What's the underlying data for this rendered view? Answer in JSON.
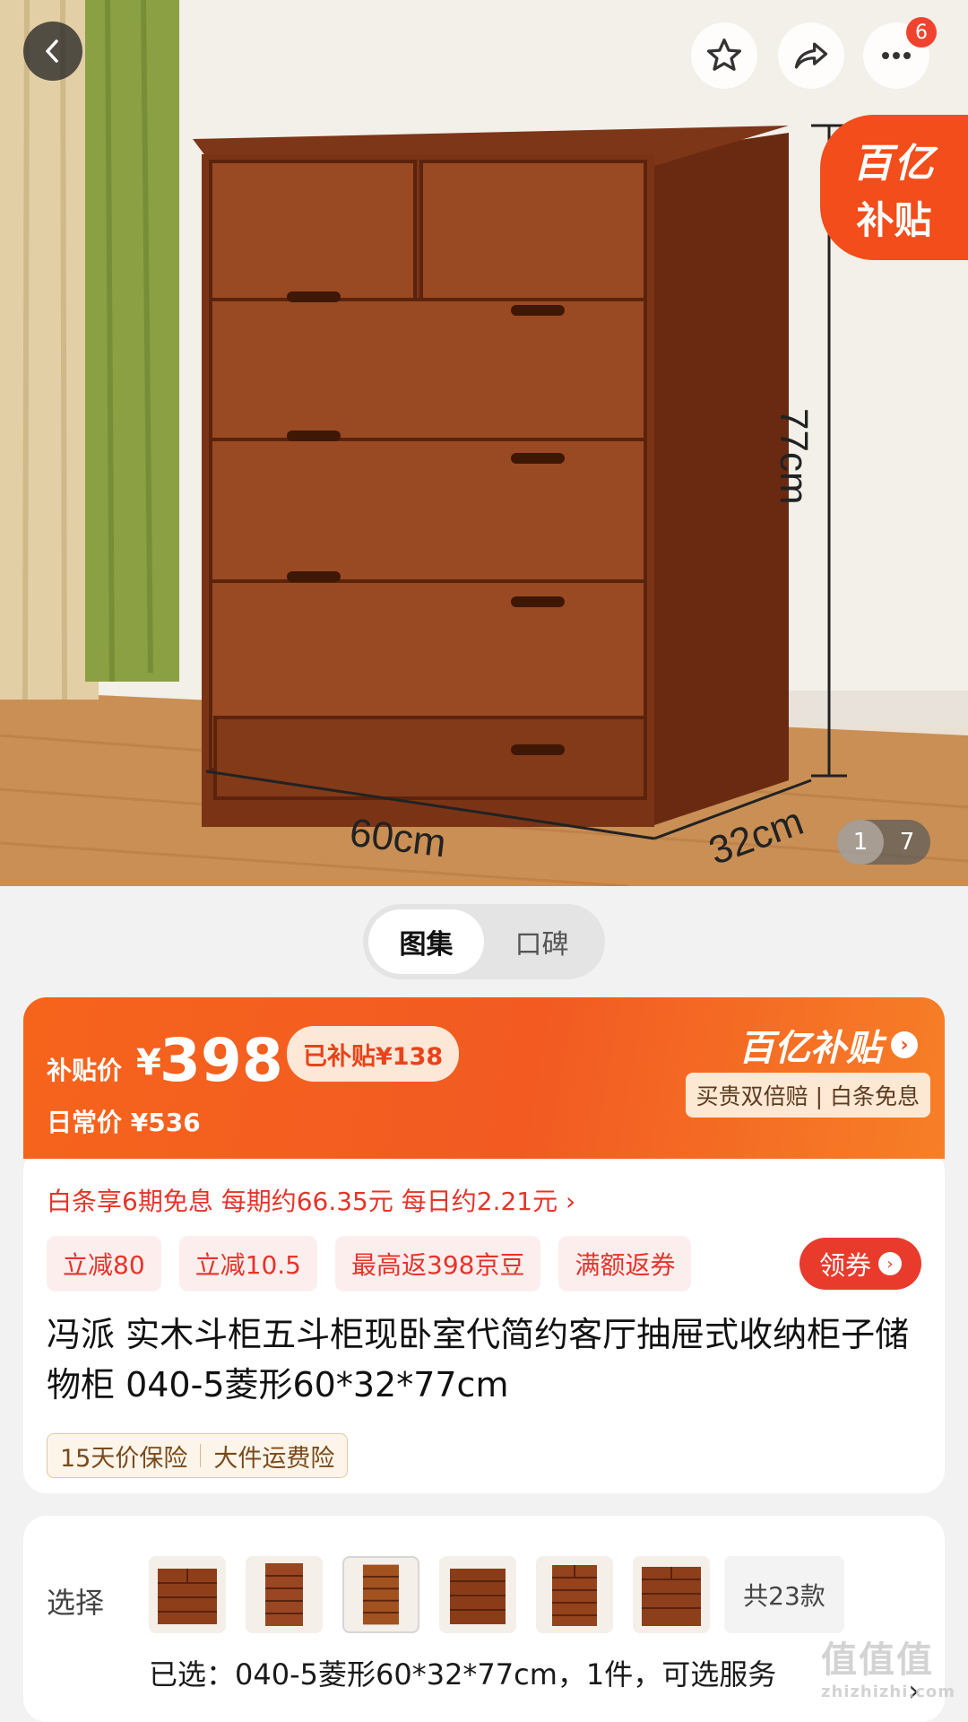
{
  "hero": {
    "dimensions": {
      "height": "77cm",
      "width": "60cm",
      "depth": "32cm"
    },
    "more_badge": "6",
    "subsidy_tag": {
      "line1": "百亿",
      "line2": "补贴"
    },
    "counter": {
      "current": "1",
      "total": "7"
    }
  },
  "tabs": [
    {
      "label": "图集"
    },
    {
      "label": "口碑"
    }
  ],
  "price": {
    "label": "补贴价",
    "currency": "¥",
    "value": "398",
    "subsidy": "已补贴¥138",
    "daily": "日常价 ¥536",
    "brand": "百亿补贴",
    "perk": "买贵双倍赔 | 白条免息"
  },
  "installment": "白条享6期免息 每期约66.35元 每日约2.21元 ›",
  "promos": [
    "立减80",
    "立减10.5",
    "最高返398京豆",
    "满额返券"
  ],
  "coupon_button": "领券",
  "product_title": "冯派 实木斗柜五斗柜现卧室代简约客厅抽屉式收纳柜子储物柜 040-5菱形60*32*77cm",
  "service_tags": [
    "15天价保险",
    "大件运费险"
  ],
  "select": {
    "label": "选择",
    "total": "共23款",
    "selected": "已选：040-5菱形60*32*77cm，1件，可选服务"
  },
  "watermark": {
    "main": "值值值",
    "sub": "zhizhizhi.com"
  },
  "colors": {
    "accent": "#f25a22",
    "red": "#e5342a",
    "wood": "#8a3e1a"
  }
}
